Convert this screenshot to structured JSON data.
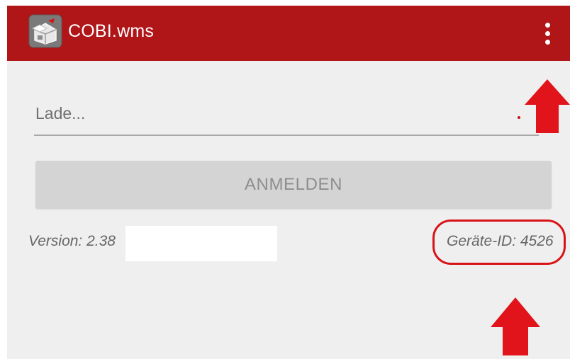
{
  "app": {
    "title": "COBI.wms",
    "icon": "cobi-box-app-icon"
  },
  "toolbar": {
    "menu_icon": "more-vert-icon"
  },
  "login": {
    "placeholder": "Lade...",
    "button_label": "ANMELDEN"
  },
  "footer": {
    "version": "Version: 2.38",
    "device_id": "Geräte-ID: 4526"
  },
  "annotations": {
    "accent_color": "#d81317"
  },
  "colors": {
    "appbar": "#b01518",
    "background": "#efefef",
    "button_disabled": "#d4d4d4"
  }
}
